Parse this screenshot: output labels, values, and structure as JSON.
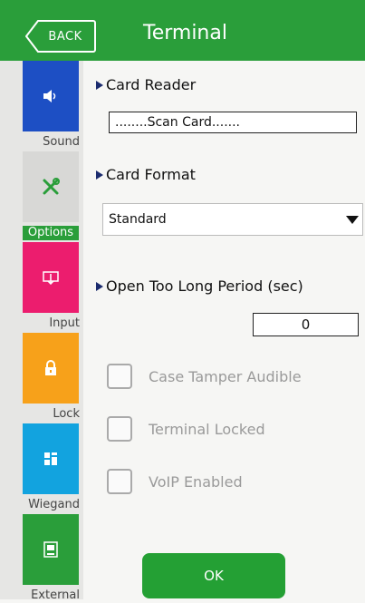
{
  "header": {
    "back_label": "BACK",
    "title": "Terminal",
    "color": "#2a9e3a"
  },
  "sidebar": {
    "items": [
      {
        "label": "Sound",
        "icon": "speaker-icon",
        "color": "#1d4fc4"
      },
      {
        "label": "Options",
        "icon": "tools-icon",
        "color": "#d8d8d6",
        "active": true
      },
      {
        "label": "Input",
        "icon": "input-icon",
        "color": "#ec1d6e"
      },
      {
        "label": "Lock",
        "icon": "lock-icon",
        "color": "#f7a11a"
      },
      {
        "label": "Wiegand",
        "icon": "wiegand-icon",
        "color": "#12a3df"
      },
      {
        "label": "External",
        "icon": "external-icon",
        "color": "#2a9e3a"
      }
    ]
  },
  "main": {
    "card_reader": {
      "label": "Card Reader",
      "value": "........Scan Card......."
    },
    "card_format": {
      "label": "Card Format",
      "selected": "Standard"
    },
    "open_too_long": {
      "label": "Open Too Long Period (sec)",
      "value": "0"
    },
    "checkboxes": [
      {
        "label": "Case Tamper Audible",
        "checked": false
      },
      {
        "label": "Terminal Locked",
        "checked": false
      },
      {
        "label": "VoIP Enabled",
        "checked": false
      }
    ],
    "ok_label": "OK"
  }
}
